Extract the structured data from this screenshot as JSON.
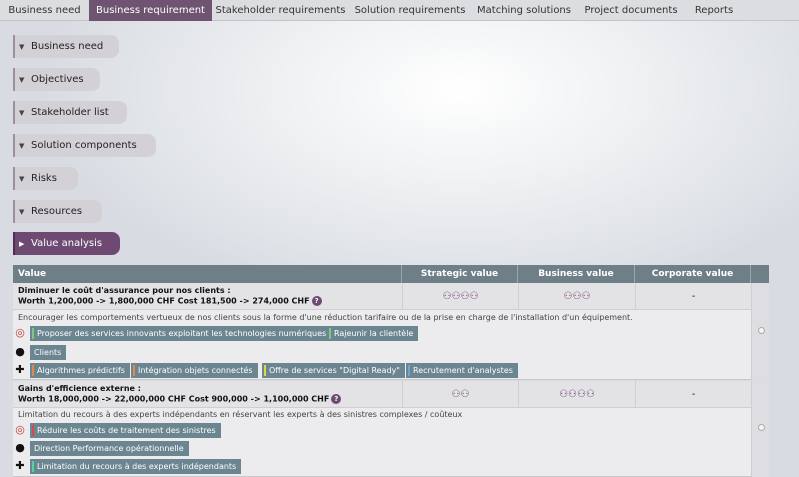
{
  "tabs": [
    {
      "label": "Business need",
      "active": false
    },
    {
      "label": "Business requirement",
      "active": true
    },
    {
      "label": "Stakeholder requirements",
      "active": false
    },
    {
      "label": "Solution requirements",
      "active": false
    },
    {
      "label": "Matching solutions",
      "active": false
    },
    {
      "label": "Project documents",
      "active": false
    },
    {
      "label": "Reports",
      "active": false
    }
  ],
  "sections": [
    {
      "label": "Business need",
      "expanded": false
    },
    {
      "label": "Objectives",
      "expanded": false
    },
    {
      "label": "Stakeholder list",
      "expanded": false
    },
    {
      "label": "Solution components",
      "expanded": false
    },
    {
      "label": "Risks",
      "expanded": false
    },
    {
      "label": "Resources",
      "expanded": false
    },
    {
      "label": "Value analysis",
      "expanded": true
    }
  ],
  "table": {
    "headers": {
      "value": "Value",
      "strategic": "Strategic value",
      "business": "Business value",
      "corporate": "Corporate value"
    },
    "rows": [
      {
        "title_line1": "Diminuer le coût d'assurance pour nos clients :",
        "title_line2": "Worth 1,200,000 -> 1,800,000 CHF Cost 181,500 -> 274,000 CHF",
        "strategic": "⚇⚇⚇⚇",
        "business": "⚇⚇⚇",
        "corporate": "-",
        "description": "Encourager les comportements vertueux de nos clients sous la forme d'une réduction tarifaire ou de la prise en charge de l'installation d'un équipement.",
        "objectives": [
          "Proposer des services innovants exploitant les technologies numériques",
          "Rajeunir la clientèle"
        ],
        "stakeholders": [
          "Clients"
        ],
        "components": [
          "Algorithmes prédictifs",
          "Intégration objets connectés",
          "Offre de services \"Digital Ready\"",
          "Recrutement d'analystes"
        ]
      },
      {
        "title_line1": "Gains d'efficience externe :",
        "title_line2": "Worth 18,000,000 -> 22,000,000 CHF Cost 900,000 -> 1,100,000 CHF",
        "strategic": "⚇⚇",
        "business": "⚇⚇⚇⚇",
        "corporate": "-",
        "description": "Limitation du recours à des experts indépendants en réservant les experts à des sinistres complexes / coûteux",
        "objectives": [
          "Réduire les coûts de traitement des sinistres"
        ],
        "stakeholders": [
          "Direction Performance opérationnelle"
        ],
        "components": [
          "Limitation du recours à des experts indépendants"
        ]
      }
    ]
  },
  "help_glyph": "?",
  "colors": {
    "accent": "#6e4a73",
    "tag": "#6b8691",
    "header": "#6f7f88"
  }
}
